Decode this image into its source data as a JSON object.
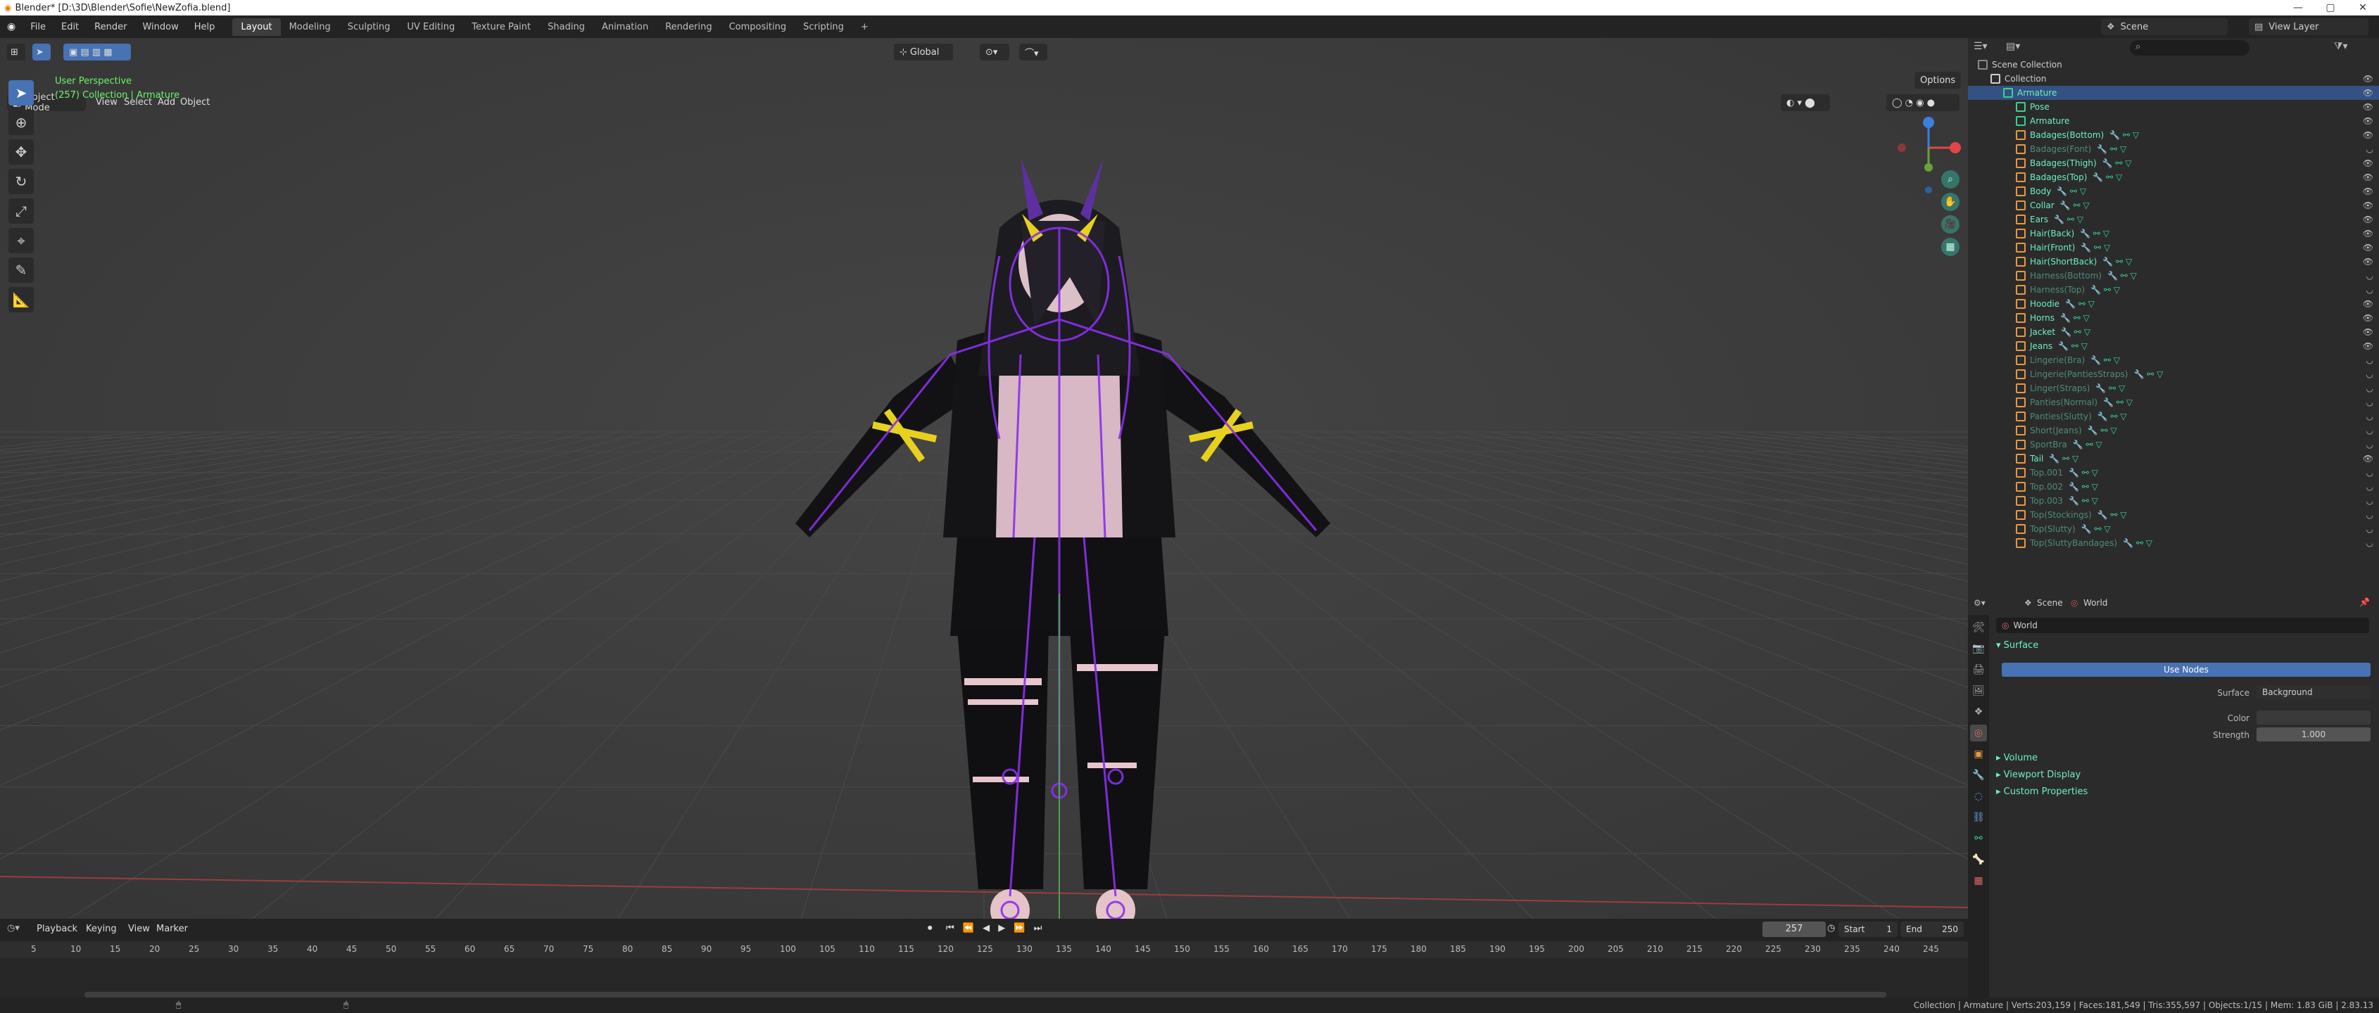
{
  "title": "Blender* [D:\\3D\\Blender\\Sofie\\NewZofia.blend]",
  "menus": [
    "File",
    "Edit",
    "Render",
    "Window",
    "Help"
  ],
  "workspaces": [
    {
      "label": "Layout",
      "active": true
    },
    {
      "label": "Modeling"
    },
    {
      "label": "Sculpting"
    },
    {
      "label": "UV Editing"
    },
    {
      "label": "Texture Paint"
    },
    {
      "label": "Shading"
    },
    {
      "label": "Animation"
    },
    {
      "label": "Rendering"
    },
    {
      "label": "Compositing"
    },
    {
      "label": "Scripting"
    }
  ],
  "scene_field": "Scene",
  "view_layer_field": "View Layer",
  "viewport": {
    "mode": "Object Mode",
    "menus": [
      "View",
      "Select",
      "Add",
      "Object"
    ],
    "orientation": "Global",
    "options": "Options",
    "info_line1": "User Perspective",
    "info_line2": "(257) Collection | Armature"
  },
  "outliner": {
    "search_placeholder": "",
    "rows": [
      {
        "label": "Scene Collection",
        "depth": 0,
        "kind": "scene"
      },
      {
        "label": "Collection",
        "depth": 1,
        "kind": "collection"
      },
      {
        "label": "Armature",
        "depth": 2,
        "kind": "armature",
        "selected": true
      },
      {
        "label": "Pose",
        "depth": 3,
        "kind": "pose"
      },
      {
        "label": "Armature",
        "depth": 3,
        "kind": "armature"
      },
      {
        "label": "Badages(Bottom)",
        "depth": 3,
        "kind": "mesh"
      },
      {
        "label": "Badages(Font)",
        "depth": 3,
        "kind": "mesh",
        "hidden": true
      },
      {
        "label": "Badages(Thigh)",
        "depth": 3,
        "kind": "mesh"
      },
      {
        "label": "Badages(Top)",
        "depth": 3,
        "kind": "mesh"
      },
      {
        "label": "Body",
        "depth": 3,
        "kind": "mesh"
      },
      {
        "label": "Collar",
        "depth": 3,
        "kind": "mesh"
      },
      {
        "label": "Ears",
        "depth": 3,
        "kind": "mesh"
      },
      {
        "label": "Hair(Back)",
        "depth": 3,
        "kind": "mesh"
      },
      {
        "label": "Hair(Front)",
        "depth": 3,
        "kind": "mesh"
      },
      {
        "label": "Hair(ShortBack)",
        "depth": 3,
        "kind": "mesh"
      },
      {
        "label": "Harness(Bottom)",
        "depth": 3,
        "kind": "mesh",
        "hidden": true
      },
      {
        "label": "Harness(Top)",
        "depth": 3,
        "kind": "mesh",
        "hidden": true
      },
      {
        "label": "Hoodie",
        "depth": 3,
        "kind": "mesh"
      },
      {
        "label": "Horns",
        "depth": 3,
        "kind": "mesh"
      },
      {
        "label": "Jacket",
        "depth": 3,
        "kind": "mesh"
      },
      {
        "label": "Jeans",
        "depth": 3,
        "kind": "mesh"
      },
      {
        "label": "Lingerie(Bra)",
        "depth": 3,
        "kind": "mesh",
        "hidden": true
      },
      {
        "label": "Lingerie(PantiesStraps)",
        "depth": 3,
        "kind": "mesh",
        "hidden": true
      },
      {
        "label": "Linger(Straps)",
        "depth": 3,
        "kind": "mesh",
        "hidden": true
      },
      {
        "label": "Panties(Normal)",
        "depth": 3,
        "kind": "mesh",
        "hidden": true
      },
      {
        "label": "Panties(Slutty)",
        "depth": 3,
        "kind": "mesh",
        "hidden": true
      },
      {
        "label": "Short(Jeans)",
        "depth": 3,
        "kind": "mesh",
        "hidden": true
      },
      {
        "label": "SportBra",
        "depth": 3,
        "kind": "mesh",
        "hidden": true
      },
      {
        "label": "Tail",
        "depth": 3,
        "kind": "mesh"
      },
      {
        "label": "Top.001",
        "depth": 3,
        "kind": "mesh",
        "hidden": true
      },
      {
        "label": "Top.002",
        "depth": 3,
        "kind": "mesh",
        "hidden": true
      },
      {
        "label": "Top.003",
        "depth": 3,
        "kind": "mesh",
        "hidden": true
      },
      {
        "label": "Top(Stockings)",
        "depth": 3,
        "kind": "mesh",
        "hidden": true
      },
      {
        "label": "Top(Slutty)",
        "depth": 3,
        "kind": "mesh",
        "hidden": true
      },
      {
        "label": "Top(SluttyBandages)",
        "depth": 3,
        "kind": "mesh",
        "hidden": true
      }
    ]
  },
  "properties": {
    "tabs": [
      "Scene",
      "World"
    ],
    "world_field": "World",
    "surface_panel": "Surface",
    "use_nodes": "Use Nodes",
    "surface_label": "Surface",
    "surface_value": "Background",
    "color_label": "Color",
    "strength_label": "Strength",
    "strength_value": "1.000",
    "volume_panel": "Volume",
    "viewport_display_panel": "Viewport Display",
    "custom_props_panel": "Custom Properties"
  },
  "timeline": {
    "menus": [
      "Playback",
      "Keying",
      "View",
      "Marker"
    ],
    "current_frame": "257",
    "start_label": "Start",
    "start_value": "1",
    "end_label": "End",
    "end_value": "250",
    "ruler": [
      "5",
      "10",
      "15",
      "20",
      "25",
      "30",
      "35",
      "40",
      "45",
      "50",
      "55",
      "60",
      "65",
      "70",
      "75",
      "80",
      "85",
      "90",
      "95",
      "100",
      "105",
      "110",
      "115",
      "120",
      "125",
      "130",
      "135",
      "140",
      "145",
      "150",
      "155",
      "160",
      "165",
      "170",
      "175",
      "180",
      "185",
      "190",
      "195",
      "200",
      "205",
      "210",
      "215",
      "220",
      "225",
      "230",
      "235",
      "240",
      "245"
    ]
  },
  "statusbar": {
    "text": "Collection | Armature | Verts:203,159 | Faces:181,549 | Tris:355,597 | Objects:1/15 | Mem: 1.83 GiB | 2.83.13"
  }
}
